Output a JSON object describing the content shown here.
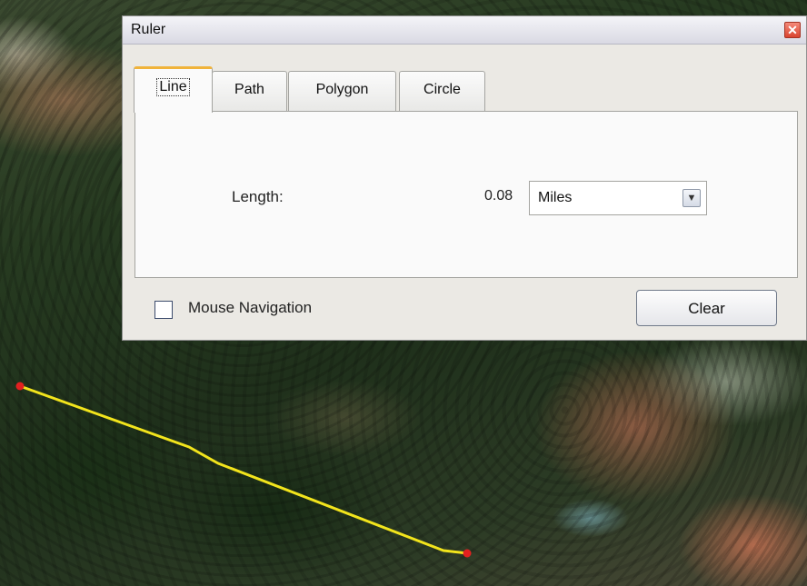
{
  "window": {
    "title": "Ruler",
    "close_glyph": "✕"
  },
  "tabs": [
    {
      "label": "Line",
      "active": true
    },
    {
      "label": "Path",
      "active": false
    },
    {
      "label": "Polygon",
      "active": false
    },
    {
      "label": "Circle",
      "active": false
    }
  ],
  "measurement": {
    "length_label": "Length:",
    "length_value": "0.08",
    "unit_selected": "Miles"
  },
  "mouse_navigation": {
    "label": "Mouse Navigation",
    "checked": false
  },
  "clear_button": {
    "label": "Clear"
  },
  "icons": {
    "close": "close-icon",
    "dropdown": "chevron-down-icon"
  },
  "colors": {
    "measure_line": "#f2e41c",
    "endpoint": "#e22020",
    "active_tab_accent": "#f0b33a",
    "close_button": "#d9442f"
  }
}
